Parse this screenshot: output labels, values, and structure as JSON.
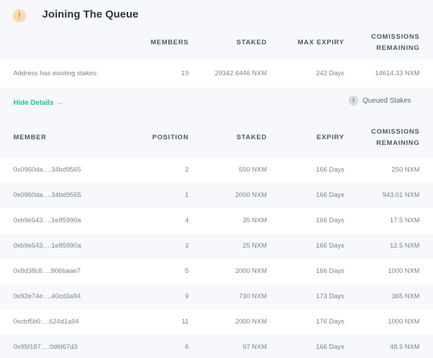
{
  "header": {
    "icon": "exclamation-icon",
    "title": "Joining The Queue"
  },
  "summary": {
    "columns": {
      "members": "MEMBERS",
      "staked": "STAKED",
      "max_expiry": "MAX EXPIRY",
      "commissions_line1": "COMISSIONS",
      "commissions_line2": "REMAINING"
    },
    "row": {
      "label": "Address has existing stakes:",
      "members": "19",
      "staked": "29342.6446 NXM",
      "max_expiry": "242 Days",
      "commissions": "14614.33 NXM"
    }
  },
  "details": {
    "toggle_label": "Hide Details →",
    "queued_icon": "exclamation-icon",
    "queued_label": "Queued Stakes"
  },
  "queue": {
    "columns": {
      "member": "MEMBER",
      "position": "POSITION",
      "staked": "STAKED",
      "expiry": "EXPIRY",
      "commissions_line1": "COMISSIONS",
      "commissions_line2": "REMAINING"
    },
    "rows": [
      {
        "member": "0x0960da….34bd9565",
        "position": "2",
        "staked": "500 NXM",
        "expiry": "166 Days",
        "commissions": "250 NXM"
      },
      {
        "member": "0x0960da….34bd9565",
        "position": "1",
        "staked": "2000 NXM",
        "expiry": "166 Days",
        "commissions": "943.01 NXM"
      },
      {
        "member": "0xb9e543….1e85990a",
        "position": "4",
        "staked": "35 NXM",
        "expiry": "166 Days",
        "commissions": "17.5 NXM"
      },
      {
        "member": "0xb9e543….1e85990a",
        "position": "3",
        "staked": "25 NXM",
        "expiry": "166 Days",
        "commissions": "12.5 NXM"
      },
      {
        "member": "0x8d38c8….806baae7",
        "position": "5",
        "staked": "2000 NXM",
        "expiry": "166 Days",
        "commissions": "1000 NXM"
      },
      {
        "member": "0x92e74e….40cd3a94",
        "position": "9",
        "staked": "730 NXM",
        "expiry": "173 Days",
        "commissions": "365 NXM"
      },
      {
        "member": "0xcbf5b0….624d1a94",
        "position": "11",
        "staked": "2000 NXM",
        "expiry": "176 Days",
        "commissions": "1000 NXM"
      },
      {
        "member": "0x95f187….0d6f67d3",
        "position": "6",
        "staked": "97 NXM",
        "expiry": "166 Days",
        "commissions": "48.5 NXM"
      }
    ]
  }
}
